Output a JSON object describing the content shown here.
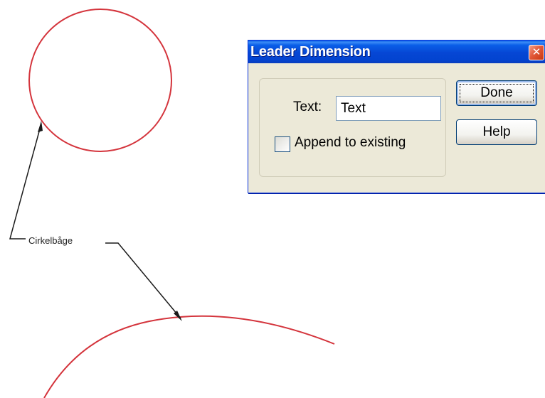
{
  "drawing": {
    "leader_text": "Cirkelbåge",
    "curve_color": "#d4343c",
    "leader_color": "#1a1a1a"
  },
  "dialog": {
    "title": "Leader Dimension",
    "close_glyph": "✕",
    "text_label": "Text:",
    "text_value": "Text",
    "append_checkbox": {
      "label": "Append to existing",
      "checked": false
    },
    "done_label": "Done",
    "help_label": "Help"
  }
}
